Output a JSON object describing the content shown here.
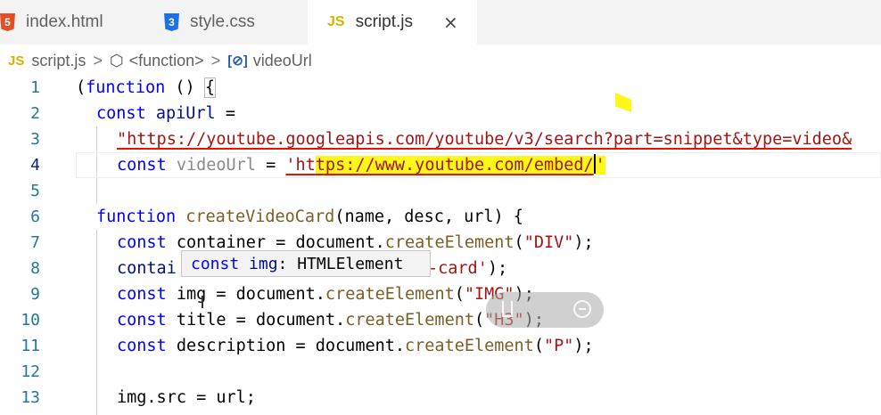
{
  "tabs": [
    {
      "icon": "html5-icon",
      "glyph": "5",
      "label": "index.html",
      "active": false
    },
    {
      "icon": "css3-icon",
      "glyph": "3",
      "label": "style.css",
      "active": false
    },
    {
      "icon": "js-file-icon",
      "glyph": "JS",
      "label": "script.js",
      "active": true,
      "close": "×"
    }
  ],
  "breadcrumb": {
    "file_icon": "JS",
    "file": "script.js",
    "separator": ">",
    "scope": "<function>",
    "symbol": "videoUrl"
  },
  "editor": {
    "line_numbers": [
      "1",
      "2",
      "3",
      "4",
      "5",
      "6",
      "7",
      "8",
      "9",
      "10",
      "11",
      "12",
      "13"
    ],
    "current_line": "4",
    "code": {
      "l1_paren": "(",
      "l1_kw": "function",
      "l1_rest": " () ",
      "l1_brace": "{",
      "l2_kw": "const",
      "l2_var": " apiUrl ",
      "l2_op": "=",
      "l3_str": "\"https://youtube.googleapis.com/youtube/v3/search?part=snippet&type=video&",
      "l4_kw": "const",
      "l4_var": " videoUrl ",
      "l4_op": "= ",
      "l4_str_a": "'ht",
      "l4_str_b": "tps://www.youtube.com/embed/",
      "l4_str_c": "'",
      "l6_kw": "function",
      "l6_fn": "createVideoCard",
      "l6_rest": "(name, desc, url) {",
      "l7_kw": "const",
      "l7_rest": " container = document.",
      "l7_fn": "createElement",
      "l7_open": "(",
      "l7_str": "\"DIV\"",
      "l7_close": ");",
      "l8_left": "contai",
      "l8_str": "-card'",
      "l8_close": ");",
      "l9_kw": "const",
      "l9_rest": " img = document.",
      "l9_fn": "createElement",
      "l9_open": "(",
      "l9_str": "\"IMG\"",
      "l9_close": ");",
      "l10_kw": "const",
      "l10_rest": " title = document.",
      "l10_fn": "createElement",
      "l10_open": "(",
      "l10_str": "\"H3\"",
      "l10_close": ");",
      "l11_kw": "const",
      "l11_rest": " description = document.",
      "l11_fn": "createElement",
      "l11_open": "(",
      "l11_str": "\"P\"",
      "l11_close": ");",
      "l13_code": "img.src = url;"
    }
  },
  "hover": {
    "kw": "const",
    "name": " img",
    "type": ": HTMLElement"
  },
  "colors": {
    "keyword": "#0000ff",
    "variable": "#001080",
    "function": "#795e26",
    "string": "#a31515",
    "line_number": "#237893",
    "highlight": "#fff71a",
    "error_squiggle": "#e51400"
  }
}
